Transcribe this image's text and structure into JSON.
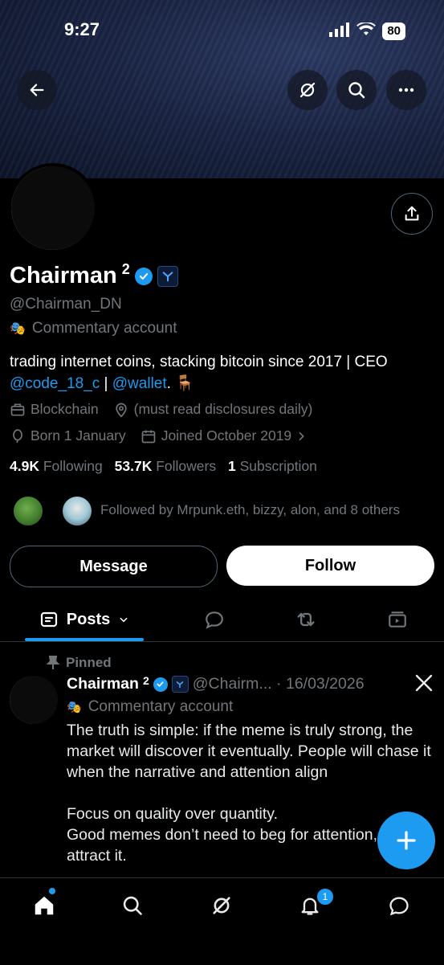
{
  "status_bar": {
    "time": "9:27",
    "battery": "80"
  },
  "profile": {
    "display_name": "Chairman",
    "superscript": "2",
    "handle": "@Chairman_DN",
    "label": "Commentary account",
    "bio_text": "trading internet coins, stacking bitcoin since 2017 | CEO",
    "bio_link1": "@code_18_c",
    "bio_sep": "|",
    "bio_link2": "@wallet",
    "bio_end": ".",
    "category": "Blockchain",
    "location": "(must read disclosures daily)",
    "born": "Born 1 January",
    "joined": "Joined October 2019",
    "following_count": "4.9K",
    "following_label": "Following",
    "followers_count": "53.7K",
    "followers_label": "Followers",
    "subs_count": "1",
    "subs_label": "Subscription",
    "followed_by": "Followed by Mrpunk.eth, bizzy, alon, and 8 others"
  },
  "actions": {
    "message": "Message",
    "follow": "Follow"
  },
  "tabs": {
    "posts": "Posts"
  },
  "pinned_post": {
    "pinned_label": "Pinned",
    "author": "Chairman",
    "superscript": "2",
    "handle_date": "@Chairm... · 16/03/2026",
    "label": "Commentary account",
    "text": "The truth is simple: if the meme is truly strong, the market will discover it eventually. People will chase it when the narrative and attention align\n\nFocus on quality over quantity.\nGood memes don’t need to beg for attention, they attract it."
  },
  "nav": {
    "notif_count": "1"
  },
  "colors": {
    "accent": "#1d9bf0",
    "muted": "#71767b",
    "background": "#000000"
  }
}
